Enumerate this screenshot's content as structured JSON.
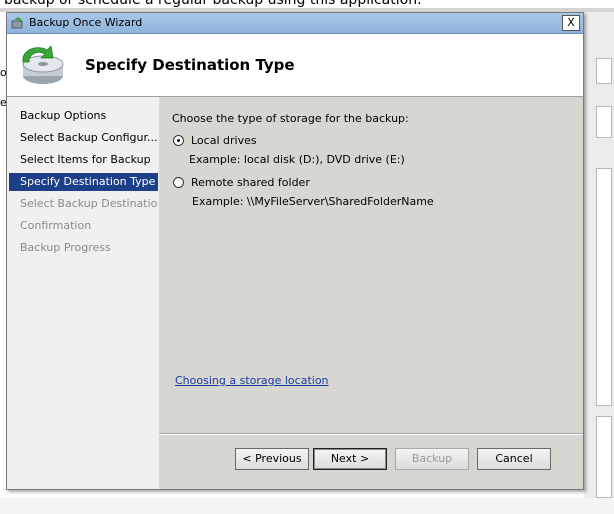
{
  "background": {
    "text": "backup or schedule a regular backup using this application.",
    "left_chars": [
      "o",
      "e"
    ]
  },
  "dialog": {
    "title": "Backup Once Wizard",
    "close_label": "X",
    "header_title": "Specify Destination Type"
  },
  "nav": {
    "items": [
      {
        "label": "Backup Options",
        "state": "normal"
      },
      {
        "label": "Select Backup Configur...",
        "state": "normal"
      },
      {
        "label": "Select Items for Backup",
        "state": "normal"
      },
      {
        "label": "Specify Destination Type",
        "state": "active"
      },
      {
        "label": "Select Backup Destination",
        "state": "disabled"
      },
      {
        "label": "Confirmation",
        "state": "disabled"
      },
      {
        "label": "Backup Progress",
        "state": "disabled"
      }
    ]
  },
  "content": {
    "prompt": "Choose the type of storage for the backup:",
    "options": [
      {
        "label": "Local drives",
        "example": "Example: local disk (D:), DVD drive (E:)",
        "selected": true
      },
      {
        "label": "Remote shared folder",
        "example": "Example: \\\\MyFileServer\\SharedFolderName",
        "selected": false
      }
    ],
    "link": "Choosing a storage location"
  },
  "buttons": {
    "previous": "< Previous",
    "next": "Next >",
    "backup": "Backup",
    "cancel": "Cancel"
  },
  "colors": {
    "selection": "#1c3f88",
    "link": "#1a3aa6",
    "titlebar": "#a8c8e8"
  }
}
